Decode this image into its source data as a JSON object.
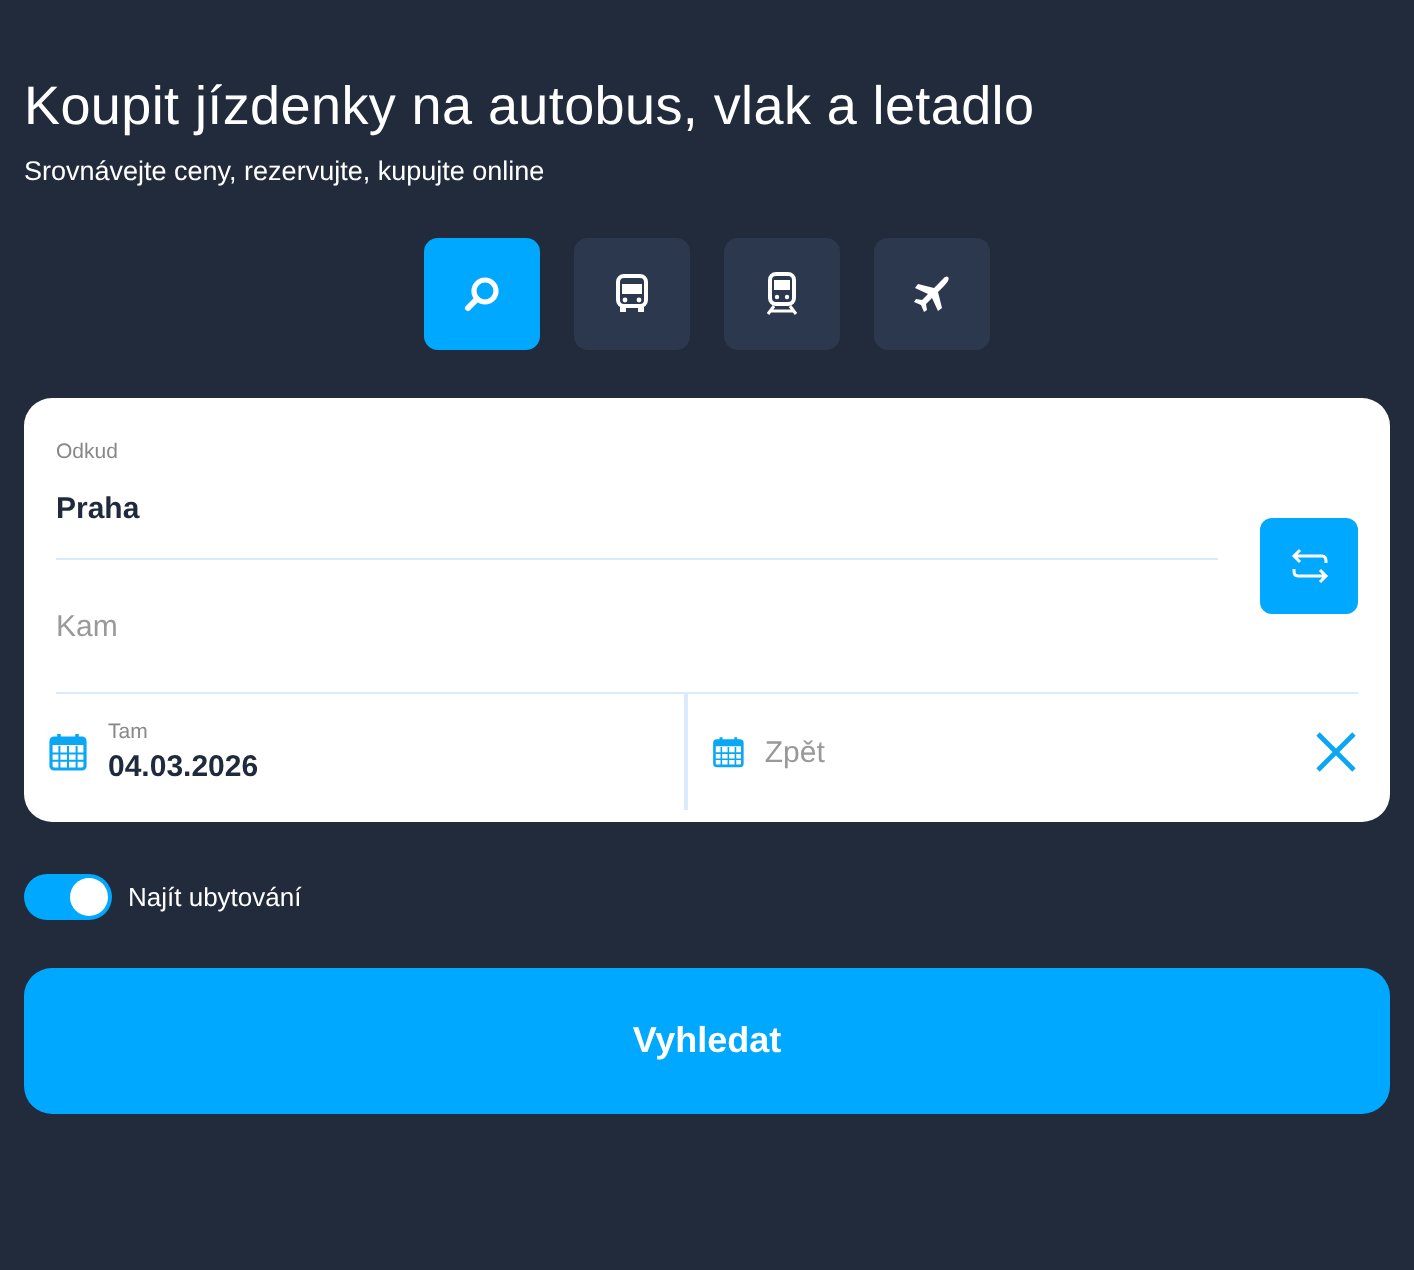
{
  "title": "Koupit jízdenky na autobus, vlak a letadlo",
  "subtitle": "Srovnávejte ceny, rezervujte, kupujte online",
  "modes": [
    {
      "kind": "search",
      "selected": true
    },
    {
      "kind": "bus",
      "selected": false
    },
    {
      "kind": "train",
      "selected": false
    },
    {
      "kind": "plane",
      "selected": false
    }
  ],
  "from": {
    "label": "Odkud",
    "value": "Praha"
  },
  "to": {
    "placeholder": "Kam"
  },
  "depart": {
    "label": "Tam",
    "value": "04.03.2026"
  },
  "return": {
    "placeholder": "Zpět"
  },
  "accommodation": {
    "label": "Najít ubytování",
    "on": true
  },
  "search_button": {
    "label": "Vyhledat"
  }
}
